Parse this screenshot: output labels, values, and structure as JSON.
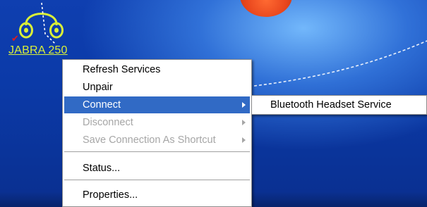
{
  "desktop": {
    "device_label": "JABRA 250",
    "device_icon": "headset-icon",
    "status_mark": "checkmark-icon"
  },
  "context_menu": {
    "items": [
      {
        "label": "Refresh Services",
        "enabled": true,
        "submenu": false
      },
      {
        "label": "Unpair",
        "enabled": true,
        "submenu": false
      },
      {
        "label": "Connect",
        "enabled": true,
        "submenu": true,
        "highlighted": true
      },
      {
        "label": "Disconnect",
        "enabled": false,
        "submenu": true
      },
      {
        "label": "Save Connection As Shortcut",
        "enabled": false,
        "submenu": true
      },
      {
        "label": "Status...",
        "enabled": true,
        "submenu": false
      },
      {
        "label": "Properties...",
        "enabled": true,
        "submenu": false
      }
    ]
  },
  "submenu": {
    "items": [
      {
        "label": "Bluetooth Headset Service"
      }
    ]
  },
  "colors": {
    "highlight": "#316ac5",
    "disabled_text": "#a6a6a6",
    "device_label": "#d9ef38"
  }
}
